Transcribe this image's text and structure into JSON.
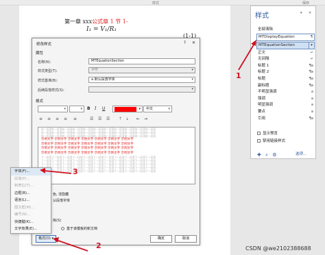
{
  "window": {
    "title": "样式",
    "share": "保存"
  },
  "doc": {
    "heading_black": "第一章 xxx",
    "heading_red": "公式章 1 节 1",
    "heading_tail": "-",
    "equation": "I₁ = V₁/R₁",
    "eq_number": "(1-1)"
  },
  "styles_pane": {
    "title": "样式",
    "items": [
      {
        "label": "全部清除",
        "mark": ""
      },
      {
        "label": "MTDisplayEquation",
        "mark": "¶"
      },
      {
        "label": "MTEquationSection",
        "mark": ""
      },
      {
        "label": "正文",
        "mark": "↵"
      },
      {
        "label": "无间隔",
        "mark": "↵"
      },
      {
        "label": "标题 1",
        "mark": "¶a"
      },
      {
        "label": "标题 2",
        "mark": "¶a"
      },
      {
        "label": "标题",
        "mark": "¶a"
      },
      {
        "label": "副标题",
        "mark": "¶a"
      },
      {
        "label": "不明显强调",
        "mark": "a"
      },
      {
        "label": "强调",
        "mark": "a"
      },
      {
        "label": "明显强调",
        "mark": "a"
      },
      {
        "label": "要点",
        "mark": "a"
      },
      {
        "label": "引用",
        "mark": "¶a"
      }
    ],
    "show_preview": "显示预览",
    "disable_linked": "禁用链接样式",
    "options_link": "选项..."
  },
  "dialog": {
    "title": "修改样式",
    "help": "?",
    "close": "✕",
    "properties_header": "属性",
    "name_label": "名称(N):",
    "name_value": "MTEquationSection",
    "type_label": "样式类型(T):",
    "type_value": "字符",
    "based_label": "样式基准(B):",
    "based_value": "a 默认段落字体",
    "next_label": "后续段落样式(S):",
    "next_value": "",
    "format_header": "格式",
    "lang_value": "中文",
    "preview_gray": "前一段落前一段落前一段落前一段落前一段落前一段落前一段落前一段落前一段落前一段落前一段落",
    "preview_red": "示例文字 示例文字 示例文字 示例文字 示例文字 示例文字 示例文字",
    "preview_gray_after": "下一段落下一段落下一段落下一段落下一段落下一段落下一段落下一段落下一段落下一段落下一段落",
    "desc1": "色, 非隐藏",
    "desc2": "认段落字体",
    "auto_update_frag": "库(S)",
    "doc_only": "基于该模板的新文档",
    "format_button": "格式(O) ▾",
    "ok": "确定",
    "cancel": "取消"
  },
  "format_menu": [
    "字体(F)...",
    "段落(P)...",
    "制表位(T)...",
    "边框(B)...",
    "语言(L)...",
    "图文框(M)...",
    "编号(N)...",
    "快捷键(K)...",
    "文字效果(E)..."
  ],
  "annotations": [
    "1",
    "2",
    "3"
  ],
  "watermark": "CSDN @we2102388688"
}
